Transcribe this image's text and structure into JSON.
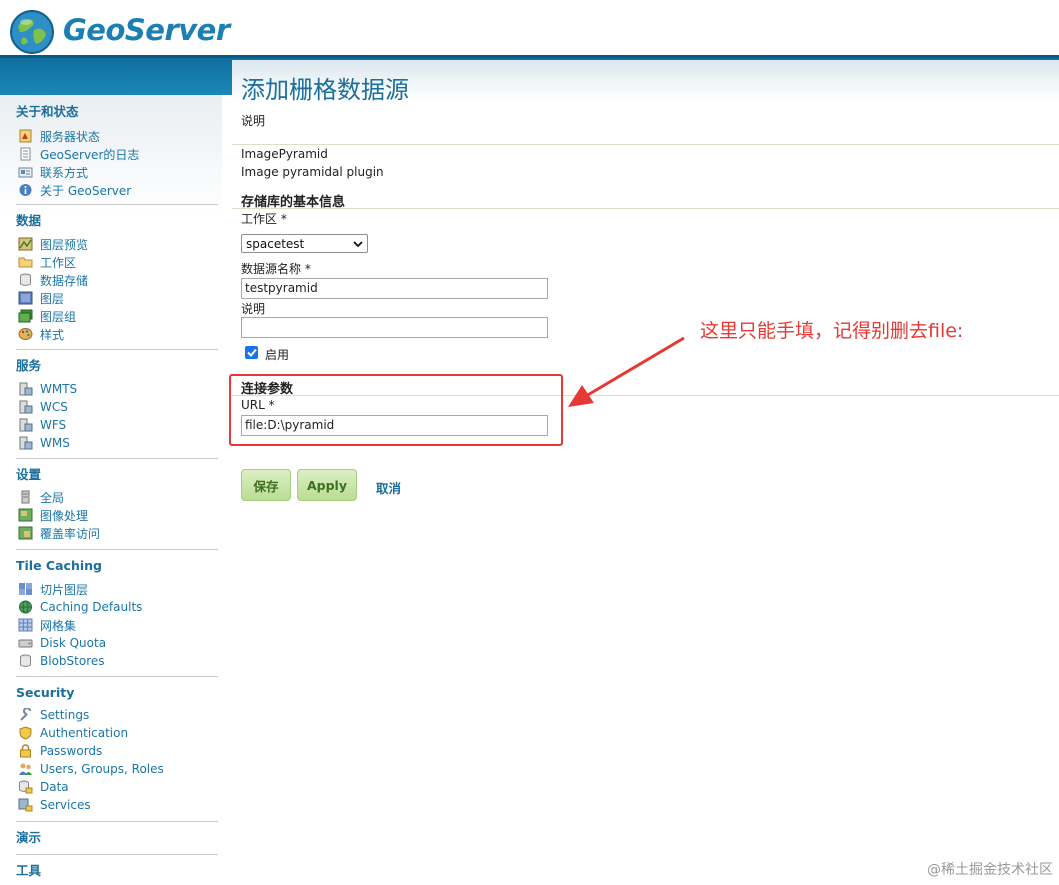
{
  "header": {
    "logo_text": "GeoServer",
    "brand_color": "#1b7fb3"
  },
  "sidebar": {
    "sections": [
      {
        "title": "关于和状态",
        "items": [
          {
            "label": "服务器状态",
            "icon": "status-icon"
          },
          {
            "label": "GeoServer的日志",
            "icon": "log-icon"
          },
          {
            "label": "联系方式",
            "icon": "contact-icon"
          },
          {
            "label": "关于 GeoServer",
            "icon": "info-icon"
          }
        ]
      },
      {
        "title": "数据",
        "items": [
          {
            "label": "图层预览",
            "icon": "layer-preview-icon"
          },
          {
            "label": "工作区",
            "icon": "folder-icon"
          },
          {
            "label": "数据存储",
            "icon": "database-icon"
          },
          {
            "label": "图层",
            "icon": "layer-icon"
          },
          {
            "label": "图层组",
            "icon": "layer-group-icon"
          },
          {
            "label": "样式",
            "icon": "palette-icon"
          }
        ]
      },
      {
        "title": "服务",
        "items": [
          {
            "label": "WMTS",
            "icon": "service-icon"
          },
          {
            "label": "WCS",
            "icon": "service-icon"
          },
          {
            "label": "WFS",
            "icon": "service-icon"
          },
          {
            "label": "WMS",
            "icon": "service-icon"
          }
        ]
      },
      {
        "title": "设置",
        "items": [
          {
            "label": "全局",
            "icon": "server-icon"
          },
          {
            "label": "图像处理",
            "icon": "image-icon"
          },
          {
            "label": "覆盖率访问",
            "icon": "coverage-icon"
          }
        ]
      },
      {
        "title": "Tile Caching",
        "items": [
          {
            "label": "切片图层",
            "icon": "tile-layer-icon"
          },
          {
            "label": "Caching Defaults",
            "icon": "globe-icon"
          },
          {
            "label": "网格集",
            "icon": "grid-icon"
          },
          {
            "label": "Disk Quota",
            "icon": "disk-icon"
          },
          {
            "label": "BlobStores",
            "icon": "blobstore-icon"
          }
        ]
      },
      {
        "title": "Security",
        "items": [
          {
            "label": "Settings",
            "icon": "wrench-icon"
          },
          {
            "label": "Authentication",
            "icon": "shield-icon"
          },
          {
            "label": "Passwords",
            "icon": "lock-icon"
          },
          {
            "label": "Users, Groups, Roles",
            "icon": "users-icon"
          },
          {
            "label": "Data",
            "icon": "data-lock-icon"
          },
          {
            "label": "Services",
            "icon": "services-lock-icon"
          }
        ]
      },
      {
        "title": "演示",
        "items": []
      },
      {
        "title": "工具",
        "items": []
      }
    ]
  },
  "main": {
    "title": "添加栅格数据源",
    "description": "说明",
    "store_type": "ImagePyramid",
    "store_type_desc": "Image pyramidal plugin",
    "basic_info_title": "存储库的基本信息",
    "workspace_label": "工作区 *",
    "workspace_value": "spacetest",
    "name_label": "数据源名称 *",
    "name_value": "testpyramid",
    "desc_label": "说明",
    "desc_value": "",
    "enabled_label": "启用",
    "conn_title": "连接参数",
    "url_label": "URL *",
    "url_value": "file:D:\\pyramid",
    "save_label": "保存",
    "apply_label": "Apply",
    "cancel_label": "取消"
  },
  "annotation": {
    "text": "这里只能手填，记得别删去file:",
    "color": "#e53935"
  },
  "watermark": "@稀土掘金技术社区"
}
